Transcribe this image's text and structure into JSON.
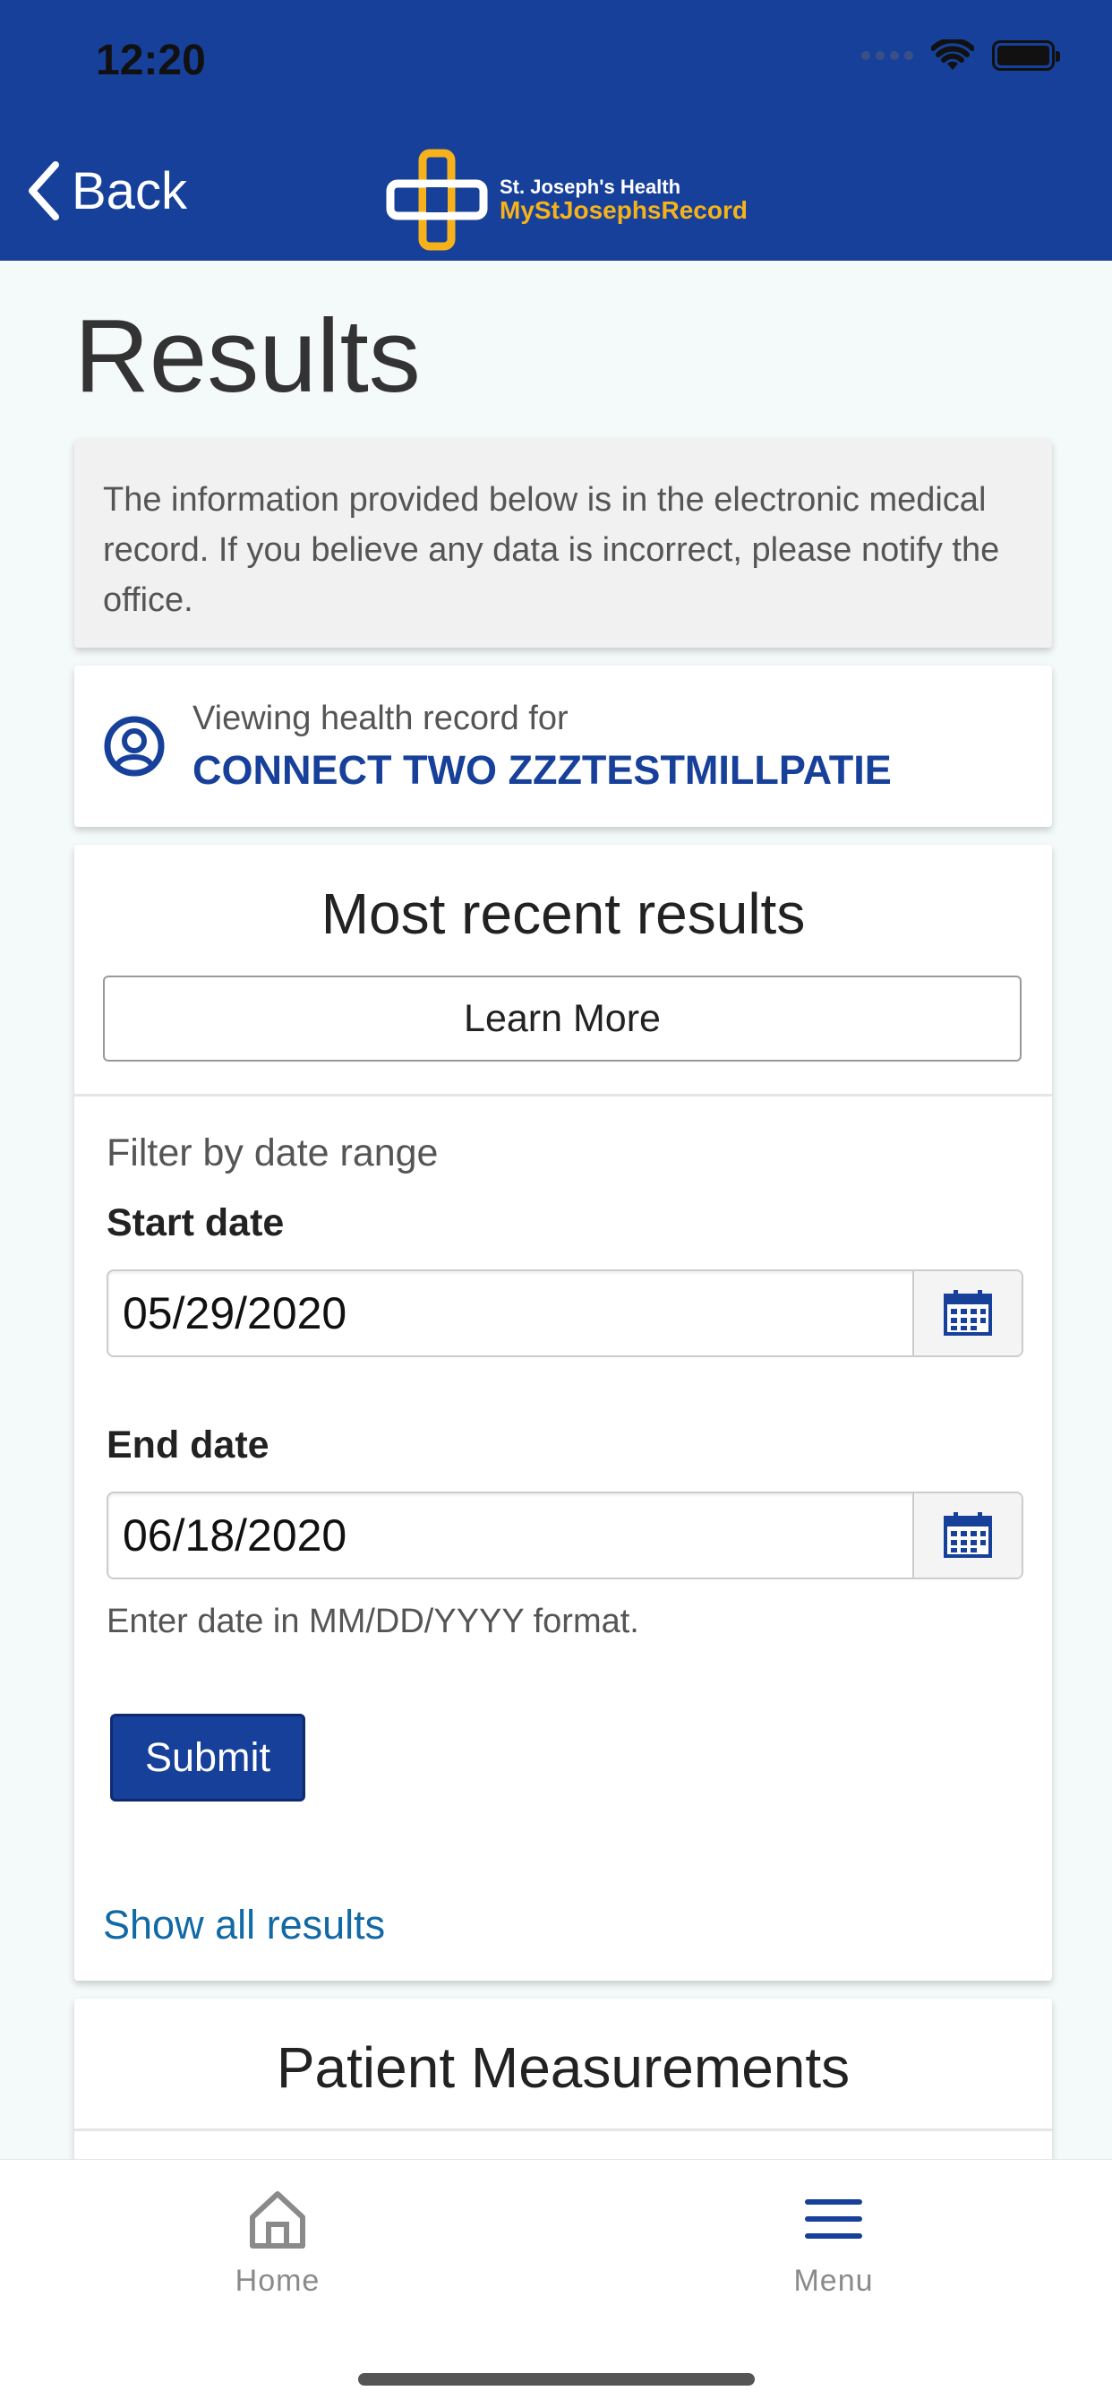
{
  "status_bar": {
    "time": "12:20"
  },
  "header": {
    "back_label": "Back",
    "logo": {
      "line1": "St. Joseph's Health",
      "line2": "MyStJosephsRecord"
    },
    "colors": {
      "background": "#17409a",
      "logo_accent": "#f6b21a"
    }
  },
  "page": {
    "title": "Results"
  },
  "notice": {
    "text": "The information provided below is in the electronic medical record. If you believe any data is incorrect, please notify the office."
  },
  "viewing": {
    "label": "Viewing health record for",
    "patient_name": "CONNECT TWO ZZZTESTMILLPATIE",
    "icon": "user-circle-icon"
  },
  "results": {
    "title": "Most recent results",
    "learn_more": "Learn More",
    "filter_label": "Filter by date range",
    "start_label": "Start date",
    "start_value": "05/29/2020",
    "end_label": "End date",
    "end_value": "06/18/2020",
    "hint": "Enter date in MM/DD/YYYY format.",
    "submit": "Submit",
    "show_all": "Show all results"
  },
  "measurements": {
    "title": "Patient Measurements"
  },
  "tabbar": {
    "items": [
      {
        "label": "Home",
        "icon": "home-icon"
      },
      {
        "label": "Menu",
        "icon": "hamburger-menu-icon"
      }
    ]
  }
}
